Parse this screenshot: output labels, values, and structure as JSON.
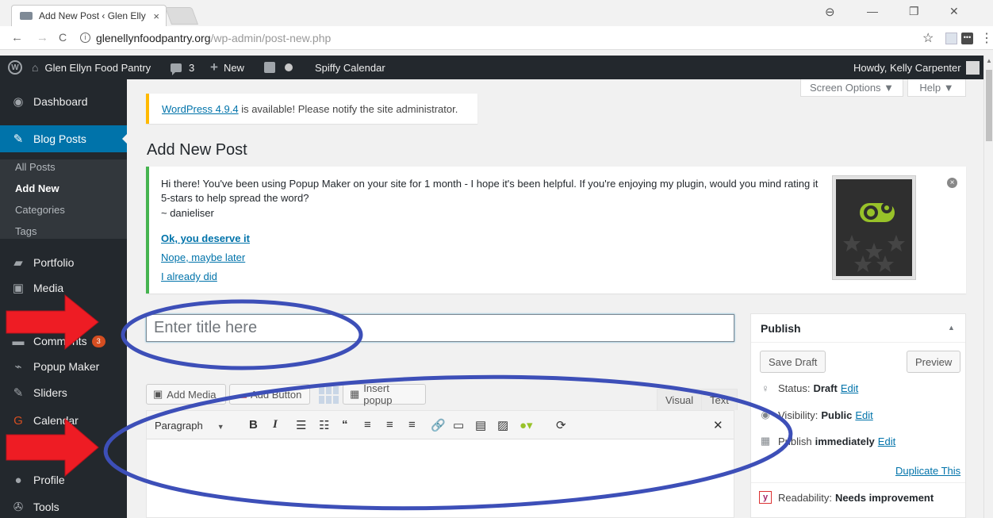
{
  "browser": {
    "tab_title": "Add New Post ‹ Glen Elly",
    "tab_close": "×",
    "url_host": "glenellynfoodpantry.org",
    "url_path": "/wp-admin/post-new.php"
  },
  "adminbar": {
    "site_name": "Glen Ellyn Food Pantry",
    "comments_count": "3",
    "new_label": "New",
    "calendar_label": "Spiffy Calendar",
    "howdy": "Howdy, Kelly Carpenter"
  },
  "sidebar": {
    "items": [
      {
        "label": "Dashboard",
        "icon": "dashboard-icon"
      },
      {
        "label": "Blog Posts",
        "icon": "pin-icon"
      },
      {
        "label": "Portfolio",
        "icon": "folder-icon"
      },
      {
        "label": "Media",
        "icon": "media-icon"
      },
      {
        "label": "Comments",
        "icon": "comment-icon",
        "badge": "3"
      },
      {
        "label": "Popup Maker",
        "icon": "popup-icon"
      },
      {
        "label": "Sliders",
        "icon": "pin-icon"
      },
      {
        "label": "Calendar",
        "icon": "calendar-icon"
      },
      {
        "label": "Profile",
        "icon": "user-icon"
      },
      {
        "label": "Tools",
        "icon": "wrench-icon"
      }
    ],
    "submenu": [
      "All Posts",
      "Add New",
      "Categories",
      "Tags"
    ]
  },
  "screen_options": {
    "screen": "Screen Options ▼",
    "help": "Help ▼"
  },
  "notice_update": {
    "link": "WordPress 4.9.4",
    "text": " is available! Please notify the site administrator."
  },
  "page_title": "Add New Post",
  "popup_notice": {
    "message": "Hi there! You've been using Popup Maker on your site for 1 month - I hope it's been helpful. If you're enjoying my plugin, would you mind rating it 5-stars to help spread the word?",
    "signature": "~ danieliser",
    "links": [
      "Ok, you deserve it",
      "Nope, maybe later",
      "I already did"
    ]
  },
  "title_input": {
    "placeholder": "Enter title here"
  },
  "editor": {
    "add_media": "Add Media",
    "add_button": "Add Button",
    "insert_popup": "Insert popup",
    "tab_visual": "Visual",
    "tab_text": "Text",
    "format": "Paragraph"
  },
  "publish": {
    "title": "Publish",
    "save_draft": "Save Draft",
    "preview": "Preview",
    "status_label": "Status:",
    "status_value": "Draft",
    "visibility_label": "Visibility:",
    "visibility_value": "Public",
    "publish_label": "Publish",
    "publish_value": "immediately",
    "edit": "Edit",
    "duplicate": "Duplicate This",
    "readability_label": "Readability:",
    "readability_value": "Needs improvement"
  },
  "colors": {
    "admin_dark": "#23282d",
    "admin_blue": "#0073aa",
    "annotation_arrow": "#ee1c24",
    "annotation_circle": "#3d4fb8"
  }
}
